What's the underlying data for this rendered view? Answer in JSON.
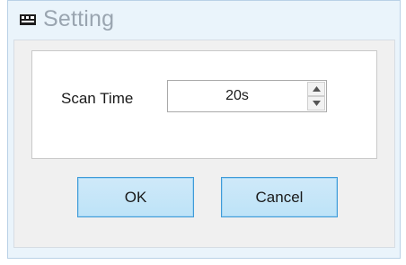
{
  "window": {
    "title": "Setting",
    "icon": "app-window-icon"
  },
  "settings": {
    "scan_time_label": "Scan Time",
    "scan_time_value": "20s"
  },
  "buttons": {
    "ok_label": "OK",
    "cancel_label": "Cancel"
  },
  "colors": {
    "title_text": "#9aa5b0",
    "button_border": "#3f9bd8",
    "button_fill": "#bde3f8",
    "frame_tint": "#eaf4fb"
  }
}
